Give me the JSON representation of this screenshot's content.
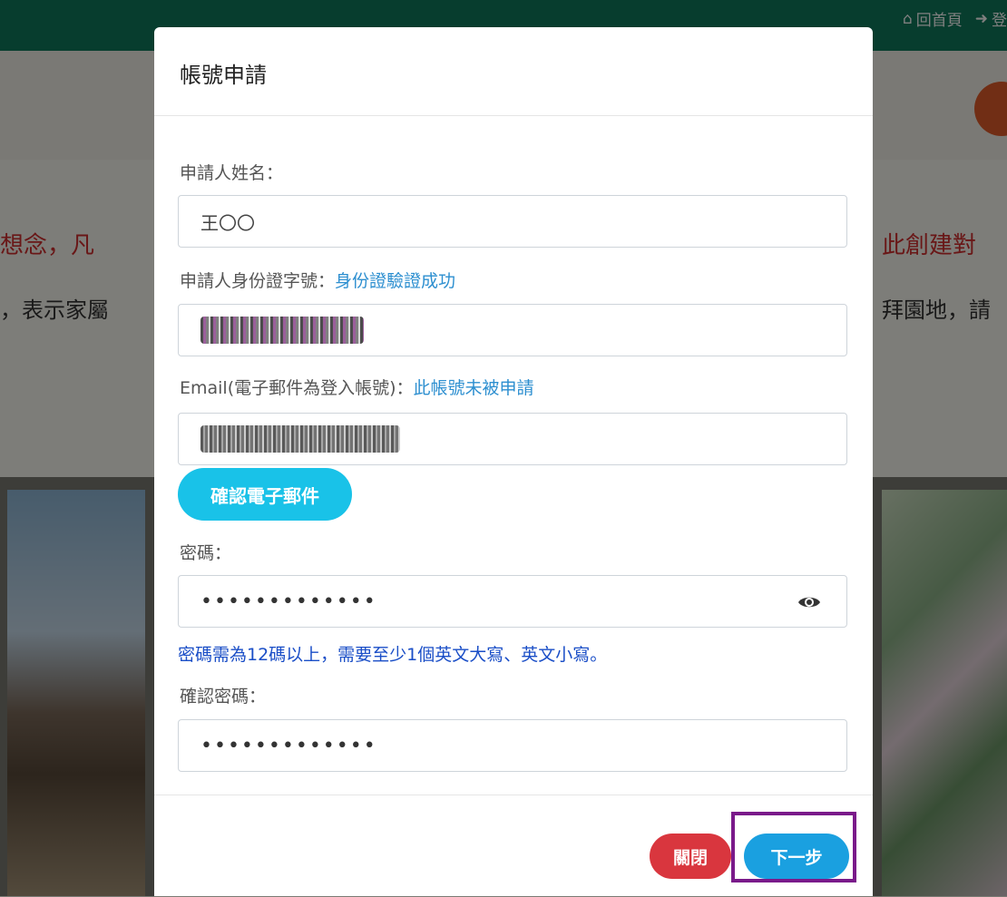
{
  "background": {
    "nav_home": "回首頁",
    "nav_login": "登",
    "hero_left_line1": "想念，凡",
    "hero_left_line2": "，表示家屬",
    "hero_right_line1": "此創建對",
    "hero_right_line2": "拜園地，請"
  },
  "modal": {
    "title": "帳號申請",
    "name_label": "申請人姓名：",
    "name_value": "王〇〇",
    "id_label": "申請人身份證字號：",
    "id_status": "身份證驗證成功",
    "email_label": "Email(電子郵件為登入帳號)：",
    "email_status": "此帳號未被申請",
    "confirm_email_button": "確認電子郵件",
    "password_label": "密碼：",
    "password_value": "•••••••••••••",
    "password_hint": "密碼需為12碼以上，需要至少1個英文大寫、英文小寫。",
    "confirm_password_label": "確認密碼：",
    "confirm_password_value": "•••••••••••••",
    "close_button": "關閉",
    "next_button": "下一步"
  },
  "colors": {
    "topbar": "#0e7a5c",
    "confirm_email_button": "#19c2e8",
    "close_button": "#d9363e",
    "next_button": "#1aa0e0",
    "highlight": "#7a1a8a"
  }
}
